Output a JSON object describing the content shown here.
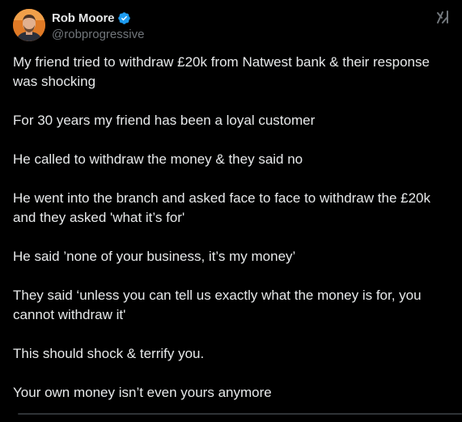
{
  "author": {
    "display_name": "Rob Moore",
    "handle": "@robprogressive",
    "verified": true
  },
  "colors": {
    "background": "#000000",
    "text": "#e7e9ea",
    "muted": "#71767b",
    "verified_badge": "#1d9bf0"
  },
  "icons": {
    "verified": "verified-badge-icon",
    "grok": "grok-icon",
    "more": "more-options-icon"
  },
  "tweet": {
    "paragraphs": [
      "My friend tried to withdraw £20k from Natwest bank & their response was shocking",
      "For 30 years my friend has been a loyal customer",
      "He called to withdraw the money & they said no",
      "He went into the branch and asked face to face to withdraw the £20k and they asked 'what it’s for'",
      "He said ’none of your business, it’s my money’",
      "They said ‘unless you can tell us exactly what the money is for, you cannot withdraw it'",
      "This should shock & terrify you.",
      "Your own money isn’t even yours anymore"
    ]
  }
}
